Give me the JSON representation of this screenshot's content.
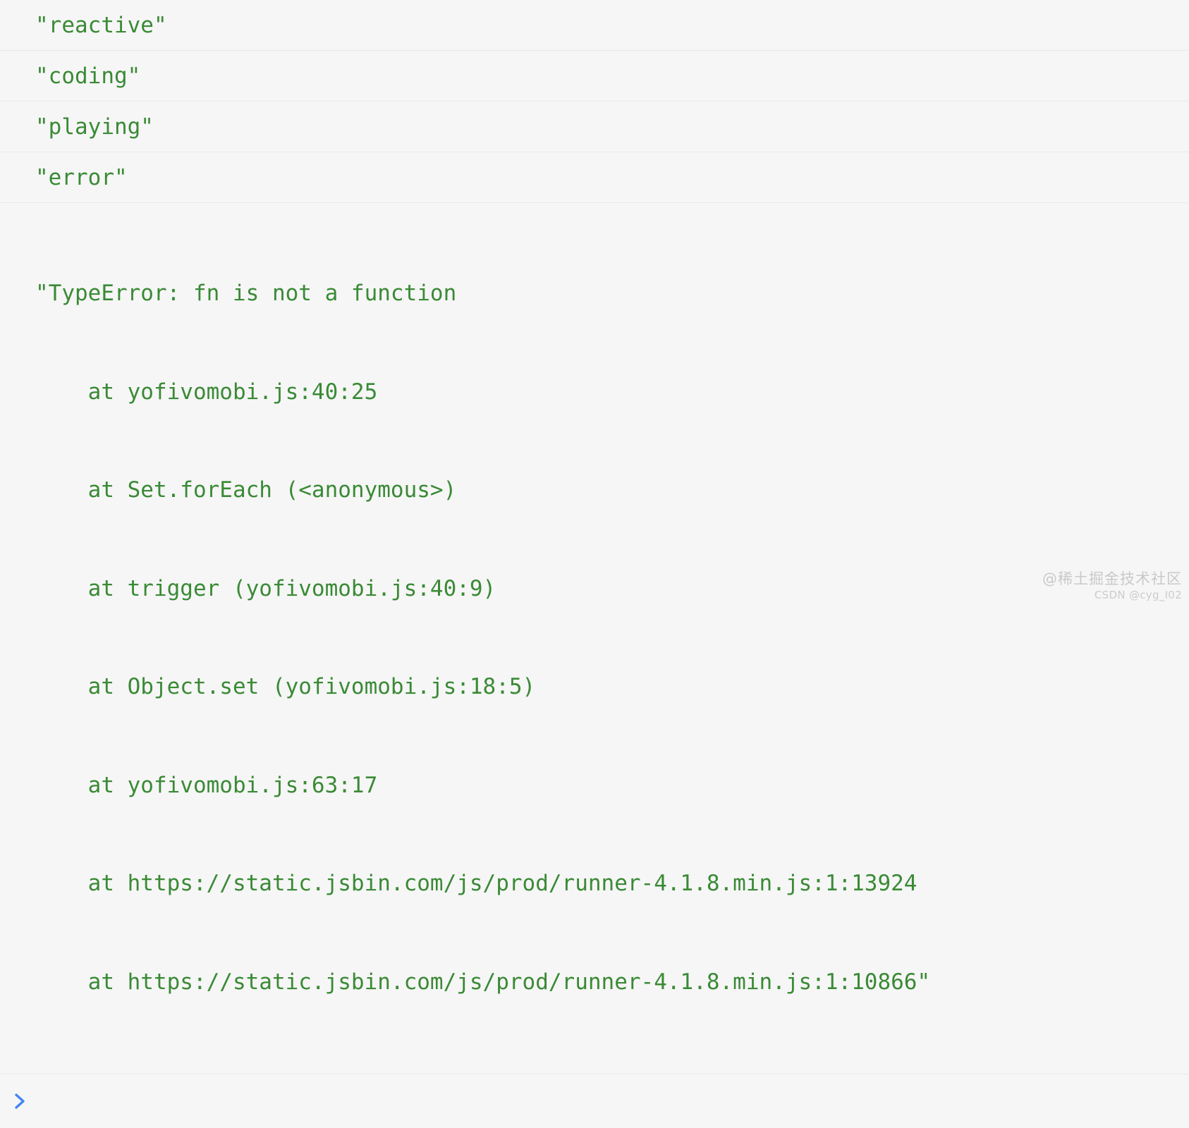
{
  "console": {
    "background_color": "#f6f6f6",
    "log_color": "#3a8a35",
    "divider_color": "#e9e9e9",
    "prompt_color": "#4285f4",
    "rows": [
      {
        "text": "\"reactive\""
      },
      {
        "text": "\"coding\""
      },
      {
        "text": "\"playing\""
      },
      {
        "text": "\"error\""
      }
    ],
    "error_block": {
      "header": "\"TypeError: fn is not a function",
      "stack": [
        "    at yofivomobi.js:40:25",
        "    at Set.forEach (<anonymous>)",
        "    at trigger (yofivomobi.js:40:9)",
        "    at Object.set (yofivomobi.js:18:5)",
        "    at yofivomobi.js:63:17",
        "    at https://static.jsbin.com/js/prod/runner-4.1.8.min.js:1:13924",
        "    at https://static.jsbin.com/js/prod/runner-4.1.8.min.js:1:10866\""
      ]
    },
    "prompt": {
      "icon": "chevron-right-icon",
      "input_value": "",
      "placeholder": ""
    }
  },
  "watermark": {
    "main": "@稀土掘金技术社区",
    "sub": "CSDN @cyg_I02"
  }
}
